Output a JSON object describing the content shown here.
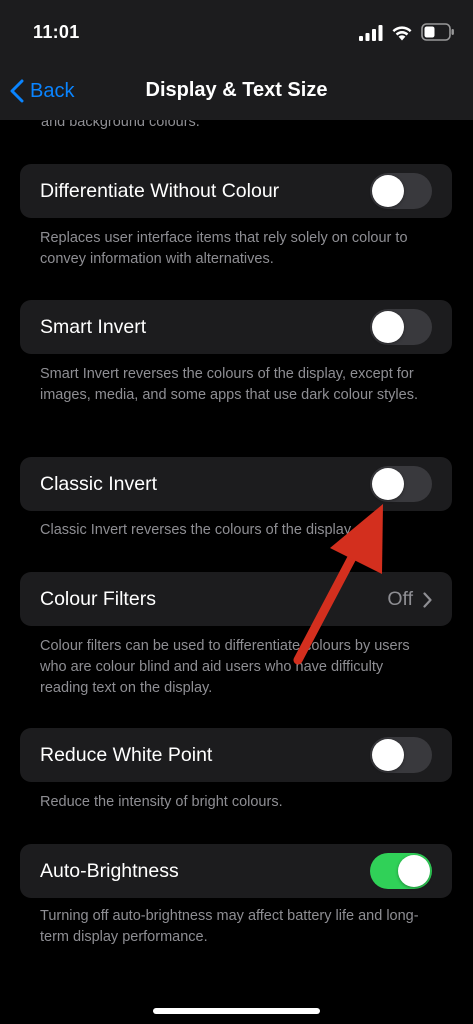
{
  "status_bar": {
    "time": "11:01",
    "icons": [
      "cellular-signal-icon",
      "wifi-icon",
      "battery-icon"
    ]
  },
  "nav": {
    "back_label": "Back",
    "title": "Display & Text Size"
  },
  "partial_footer": "and background colours.",
  "rows": [
    {
      "label": "Differentiate Without Colour",
      "control": "toggle",
      "state": "off",
      "footer": "Replaces user interface items that rely solely on colour to convey information with alternatives."
    },
    {
      "label": "Smart Invert",
      "control": "toggle",
      "state": "off",
      "footer": "Smart Invert reverses the colours of the display, except for images, media, and some apps that use dark colour styles."
    },
    {
      "label": "Classic Invert",
      "control": "toggle",
      "state": "off",
      "footer": "Classic Invert reverses the colours of the display."
    },
    {
      "label": "Colour Filters",
      "control": "disclosure",
      "value": "Off",
      "footer": "Colour filters can be used to differentiate colours by users who are colour blind and aid users who have difficulty reading text on the display."
    },
    {
      "label": "Reduce White Point",
      "control": "toggle",
      "state": "off",
      "footer": "Reduce the intensity of bright colours."
    },
    {
      "label": "Auto-Brightness",
      "control": "toggle",
      "state": "on",
      "footer": "Turning off auto-brightness may affect battery life and long-term display performance."
    }
  ],
  "colors": {
    "accent": "#0a84ff",
    "toggle_on": "#30d158",
    "toggle_off": "#39393d",
    "cell_background": "#1c1c1e",
    "secondary_text": "#8e8e93",
    "annotation_arrow": "#d32f1e"
  }
}
